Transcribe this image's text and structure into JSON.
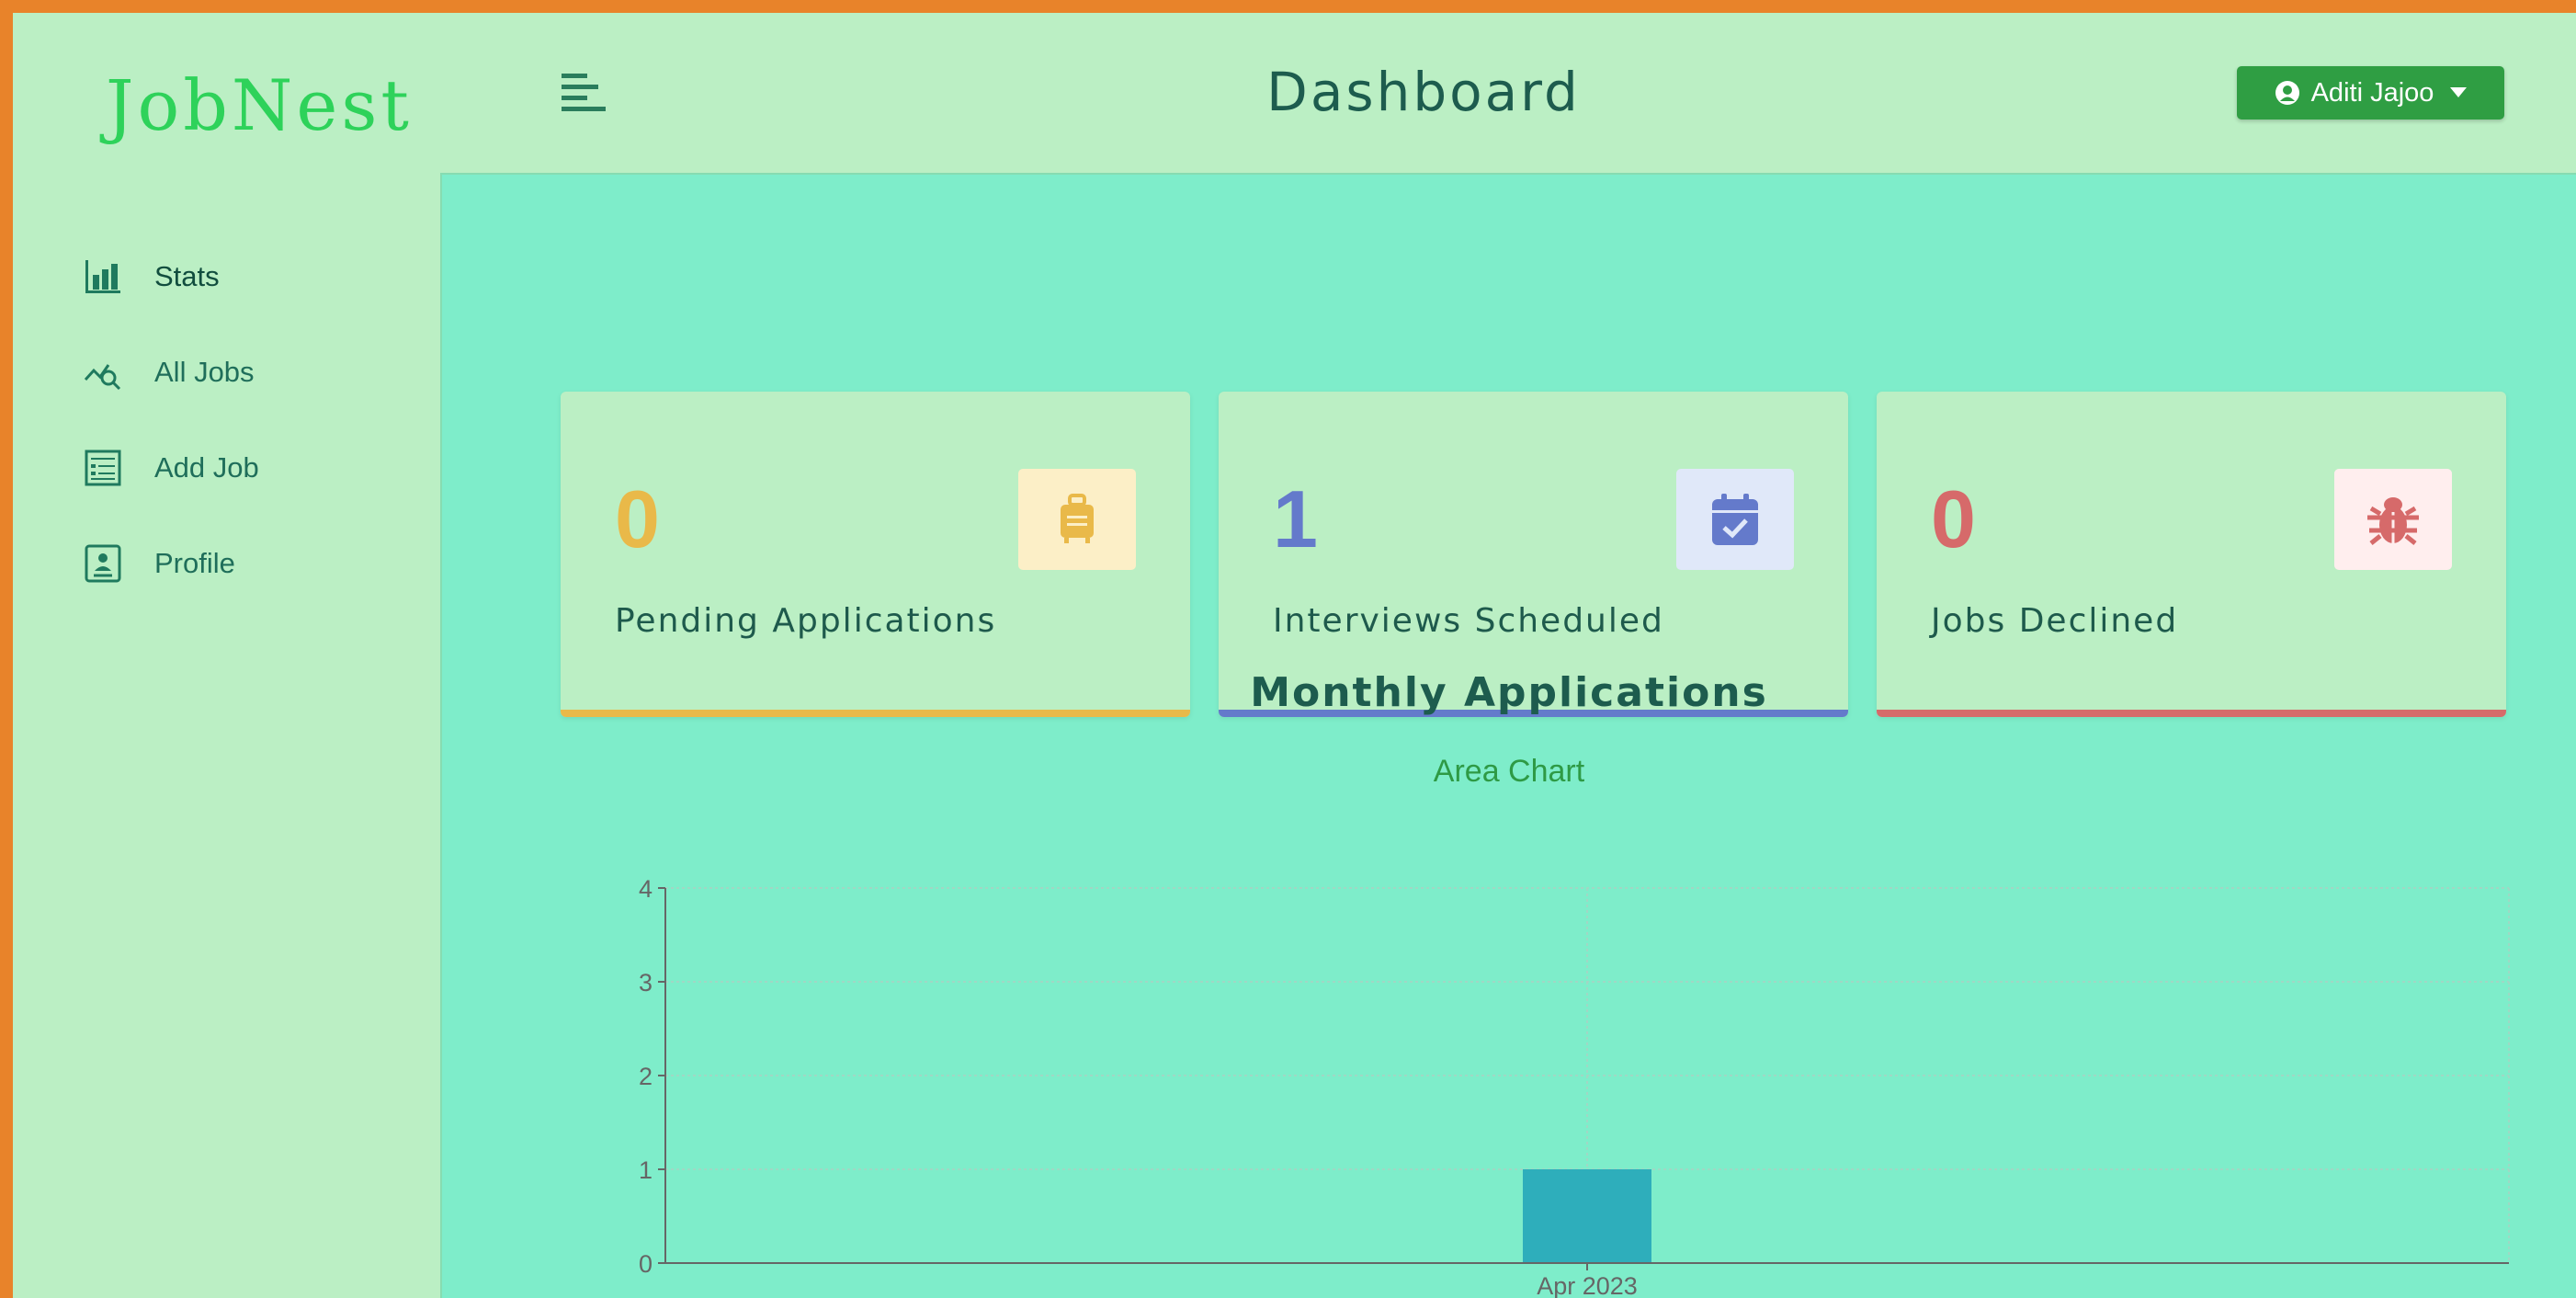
{
  "app": {
    "logo": "JobNest"
  },
  "header": {
    "title": "Dashboard",
    "user_name": "Aditi Jajoo"
  },
  "sidebar": {
    "items": [
      {
        "label": "Stats",
        "icon": "bar-chart-icon"
      },
      {
        "label": "All Jobs",
        "icon": "chart-search-icon"
      },
      {
        "label": "Add Job",
        "icon": "form-icon"
      },
      {
        "label": "Profile",
        "icon": "id-card-icon"
      }
    ]
  },
  "stats": [
    {
      "count": "0",
      "label": "Pending Applications",
      "icon": "suitcase-icon",
      "color": "#e9b949",
      "badge_bg": "#fcefc7"
    },
    {
      "count": "1",
      "label": "Interviews Scheduled",
      "icon": "calendar-check-icon",
      "color": "#647acb",
      "badge_bg": "#e0e8f9"
    },
    {
      "count": "0",
      "label": "Jobs Declined",
      "icon": "bug-icon",
      "color": "#d66a6a",
      "badge_bg": "#ffeeee"
    }
  ],
  "chart_section": {
    "title": "Monthly Applications",
    "toggle_label": "Area Chart"
  },
  "chart_data": {
    "type": "bar",
    "categories": [
      "Apr 2023"
    ],
    "values": [
      1
    ],
    "ylim": [
      0,
      4
    ],
    "yticks": [
      "0",
      "1",
      "2",
      "3",
      "4"
    ],
    "grid": true,
    "bar_color": "#2eaebb"
  }
}
